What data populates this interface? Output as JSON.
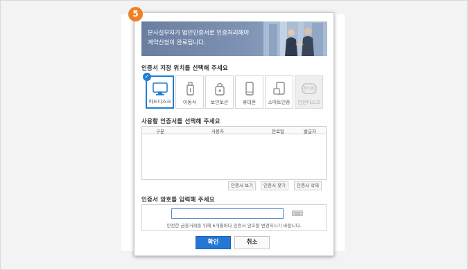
{
  "step_number": "5",
  "banner": {
    "message": "본사실무자가 법인인증서로 인증처리해야\n계약신청이 완료됩니다."
  },
  "storage": {
    "title": "인증서 저장 위치를 선택해 주세요",
    "devices": [
      {
        "label": "하드디스크",
        "icon": "monitor-icon",
        "selected": true,
        "disabled": false
      },
      {
        "label": "이동식",
        "icon": "usb-icon",
        "selected": false,
        "disabled": false
      },
      {
        "label": "보안토큰",
        "icon": "security-token-icon",
        "selected": false,
        "disabled": false
      },
      {
        "label": "휴대폰",
        "icon": "mobile-phone-icon",
        "selected": false,
        "disabled": false
      },
      {
        "label": "스마트인증",
        "icon": "smart-auth-icon",
        "selected": false,
        "disabled": false
      },
      {
        "label": "안전디스크",
        "icon": "safe-disk-icon",
        "badge": "준비중",
        "selected": false,
        "disabled": true
      }
    ]
  },
  "certificate_list": {
    "title": "사용할 인증서를 선택해 주세요",
    "columns": [
      "구분",
      "사용자",
      "만료일",
      "발급자"
    ],
    "rows": [],
    "actions": [
      "인증서 보기",
      "인증서 찾기",
      "인증서 삭제"
    ]
  },
  "password": {
    "title": "인증서 암호를 입력해 주세요",
    "value": "",
    "notice": "안전한 금융거래를 위해 6개월마다 인증서 암호를 변경하시기 바랍니다."
  },
  "buttons": {
    "confirm": "확인",
    "cancel": "취소"
  },
  "colors": {
    "accent": "#2478d4",
    "step_badge": "#f07f25"
  }
}
